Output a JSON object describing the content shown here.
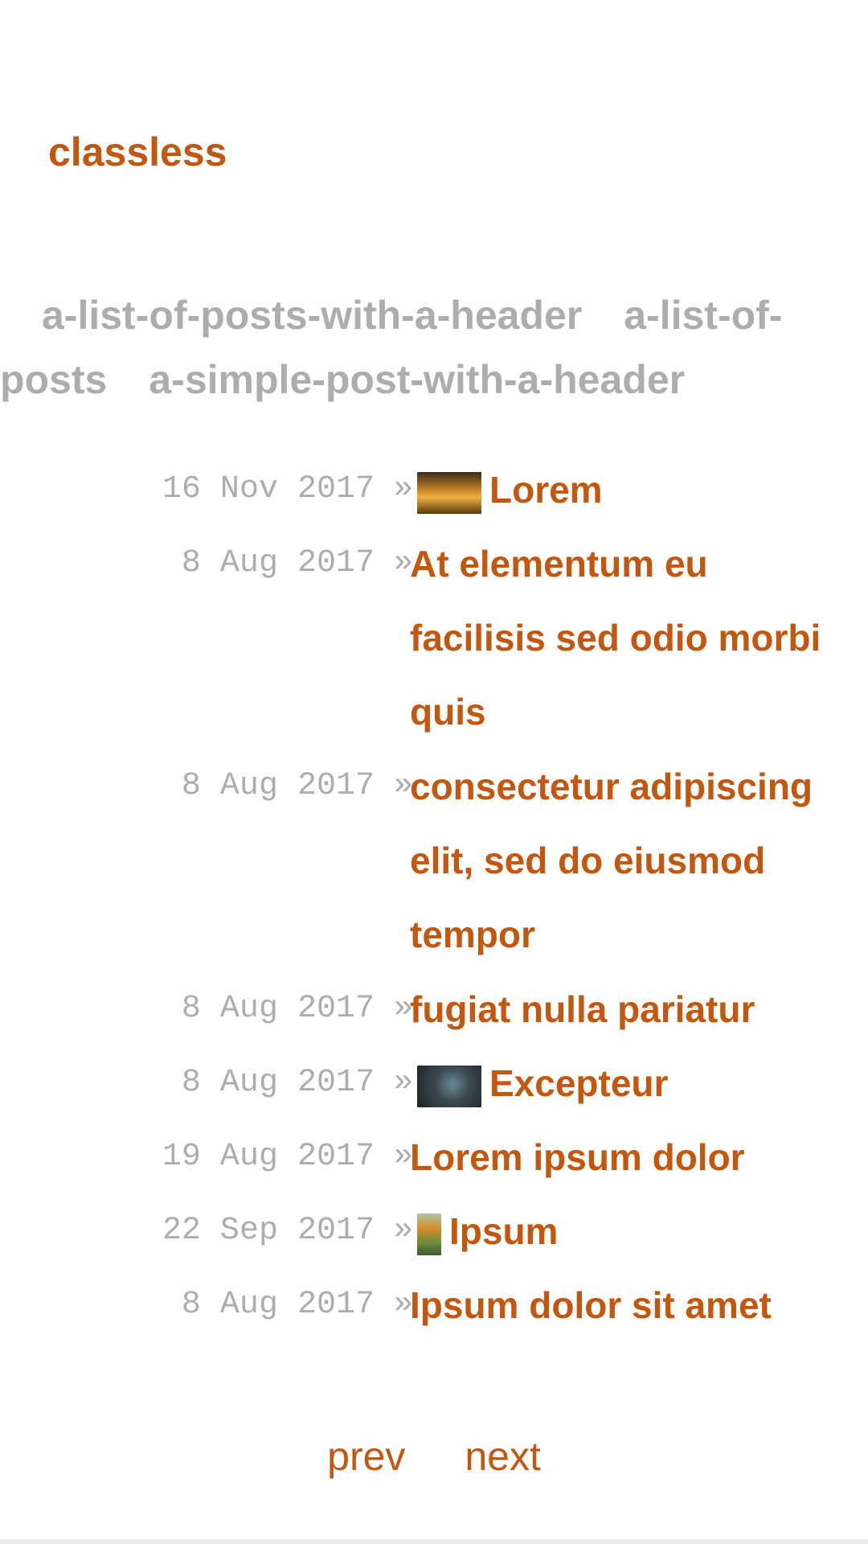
{
  "site": {
    "title": "classless"
  },
  "nav": {
    "links": [
      "a-list-of-posts-with-a-header",
      "a-list-of-posts",
      "a-simple-post-with-a-header"
    ]
  },
  "posts": [
    {
      "date": "16 Nov 2017",
      "sep": "»",
      "title": "Lorem",
      "thumbnail": "sunset-photo"
    },
    {
      "date": "8 Aug 2017",
      "sep": "»",
      "title": "At elementum eu facilisis sed odio morbi quis",
      "thumbnail": null
    },
    {
      "date": "8 Aug 2017",
      "sep": "»",
      "title": "consectetur adipiscing elit, sed do eiusmod tempor",
      "thumbnail": null
    },
    {
      "date": "8 Aug 2017",
      "sep": "»",
      "title": "fugiat nulla pariatur",
      "thumbnail": null
    },
    {
      "date": "8 Aug 2017",
      "sep": "»",
      "title": "Excepteur",
      "thumbnail": "dark-portrait-photo"
    },
    {
      "date": "19 Aug 2017",
      "sep": "»",
      "title": "Lorem ipsum dolor",
      "thumbnail": null
    },
    {
      "date": "22 Sep 2017",
      "sep": "»",
      "title": "Ipsum",
      "thumbnail": "flower-photo"
    },
    {
      "date": "8 Aug 2017",
      "sep": "»",
      "title": "Ipsum dolor sit amet",
      "thumbnail": null
    }
  ],
  "pagination": {
    "prev": "prev",
    "next": "next"
  },
  "colors": {
    "accent": "#c4570f",
    "muted": "#adadad"
  }
}
